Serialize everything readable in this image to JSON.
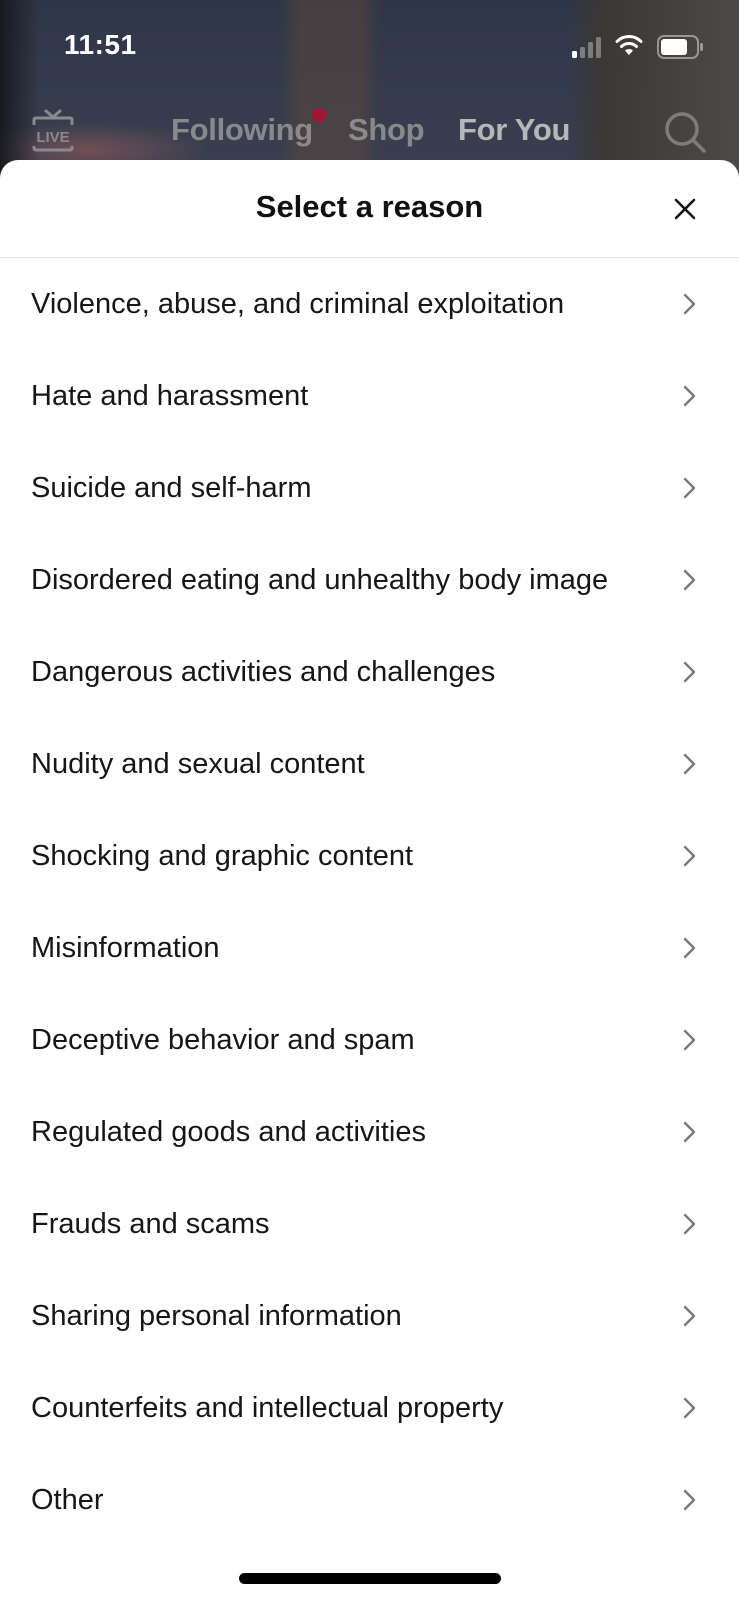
{
  "status_bar": {
    "time": "11:51",
    "signal_icon": "cellular-signal-icon",
    "wifi_icon": "wifi-icon",
    "battery_icon": "battery-icon"
  },
  "top_nav": {
    "live_icon": "live-tv-icon",
    "tabs": [
      {
        "label": "Following",
        "has_notification_dot": true
      },
      {
        "label": "Shop"
      },
      {
        "label": "For You",
        "active": true
      }
    ],
    "search_icon": "search-icon",
    "notification_dot_color": "#a3162f"
  },
  "sheet": {
    "title": "Select a reason",
    "close_icon": "close-icon",
    "reasons": [
      {
        "label": "Violence, abuse, and criminal exploitation"
      },
      {
        "label": "Hate and harassment"
      },
      {
        "label": "Suicide and self-harm"
      },
      {
        "label": "Disordered eating and unhealthy body image"
      },
      {
        "label": "Dangerous activities and challenges"
      },
      {
        "label": "Nudity and sexual content"
      },
      {
        "label": "Shocking and graphic content"
      },
      {
        "label": "Misinformation"
      },
      {
        "label": "Deceptive behavior and spam"
      },
      {
        "label": "Regulated goods and activities"
      },
      {
        "label": "Frauds and scams"
      },
      {
        "label": "Sharing personal information"
      },
      {
        "label": "Counterfeits and intellectual property"
      },
      {
        "label": "Other"
      }
    ]
  }
}
